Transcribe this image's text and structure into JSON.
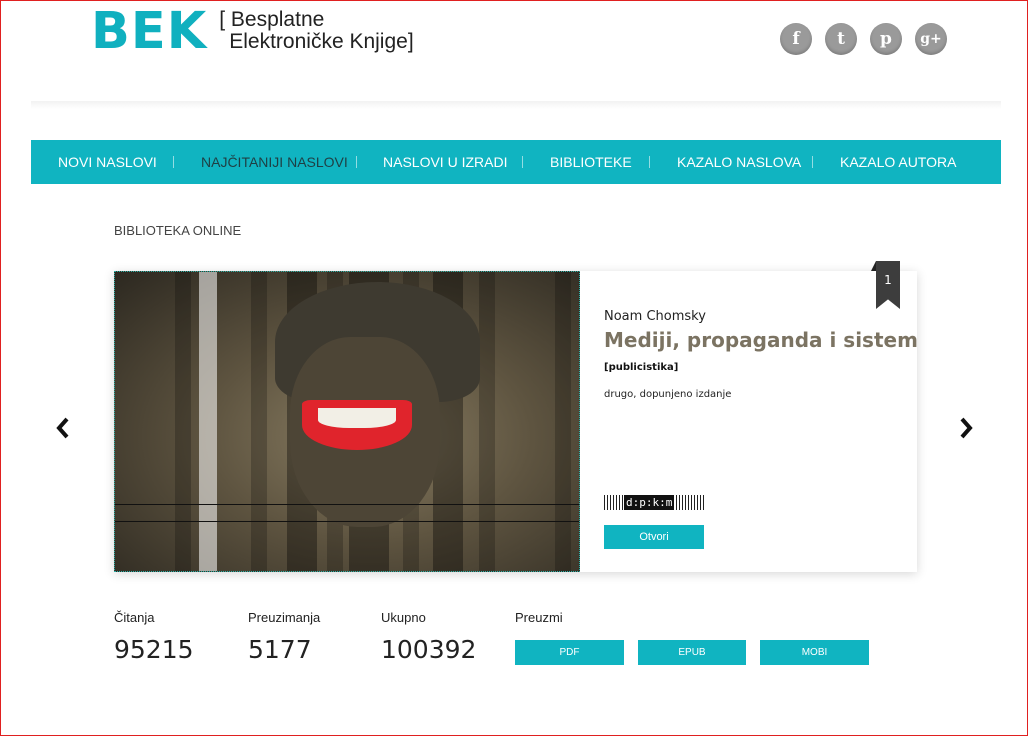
{
  "header": {
    "logo_mark": "BEK",
    "logo_line1": "[ Besplatne",
    "logo_line2": "Elektroničke Knjige]",
    "social": [
      {
        "icon": "facebook-icon",
        "glyph": "f"
      },
      {
        "icon": "twitter-icon",
        "glyph": "t"
      },
      {
        "icon": "pinterest-icon",
        "glyph": "p"
      },
      {
        "icon": "googleplus-icon",
        "glyph": "g+"
      }
    ]
  },
  "nav": {
    "items": [
      {
        "label": "NOVI NASLOVI"
      },
      {
        "label": "NAJČITANIJI NASLOVI",
        "active": true
      },
      {
        "label": "NASLOVI U IZRADI"
      },
      {
        "label": "BIBLIOTEKE"
      },
      {
        "label": "KAZALO NASLOVA"
      },
      {
        "label": "KAZALO AUTORA"
      }
    ]
  },
  "section": {
    "title": "BIBLIOTEKA ONLINE"
  },
  "slider": {
    "prev_icon": "‹",
    "next_icon": "›",
    "rank": "1",
    "book": {
      "author": "Noam Chomsky",
      "title": "Mediji, propaganda i sistem",
      "genre": "[publicistika]",
      "edition": "drugo, dopunjeno izdanje",
      "barcode_text": "d:p:k:m",
      "open_label": "Otvori"
    }
  },
  "stats": {
    "reads_label": "Čitanja",
    "reads_value": "95215",
    "downloads_label": "Preuzimanja",
    "downloads_value": "5177",
    "total_label": "Ukupno",
    "total_value": "100392"
  },
  "download": {
    "label": "Preuzmi",
    "pdf": "PDF",
    "epub": "EPUB",
    "mobi": "MOBI"
  },
  "colors": {
    "accent": "#10b4c1",
    "title_brown": "#7b7362",
    "ribbon": "#3d3d3d"
  }
}
